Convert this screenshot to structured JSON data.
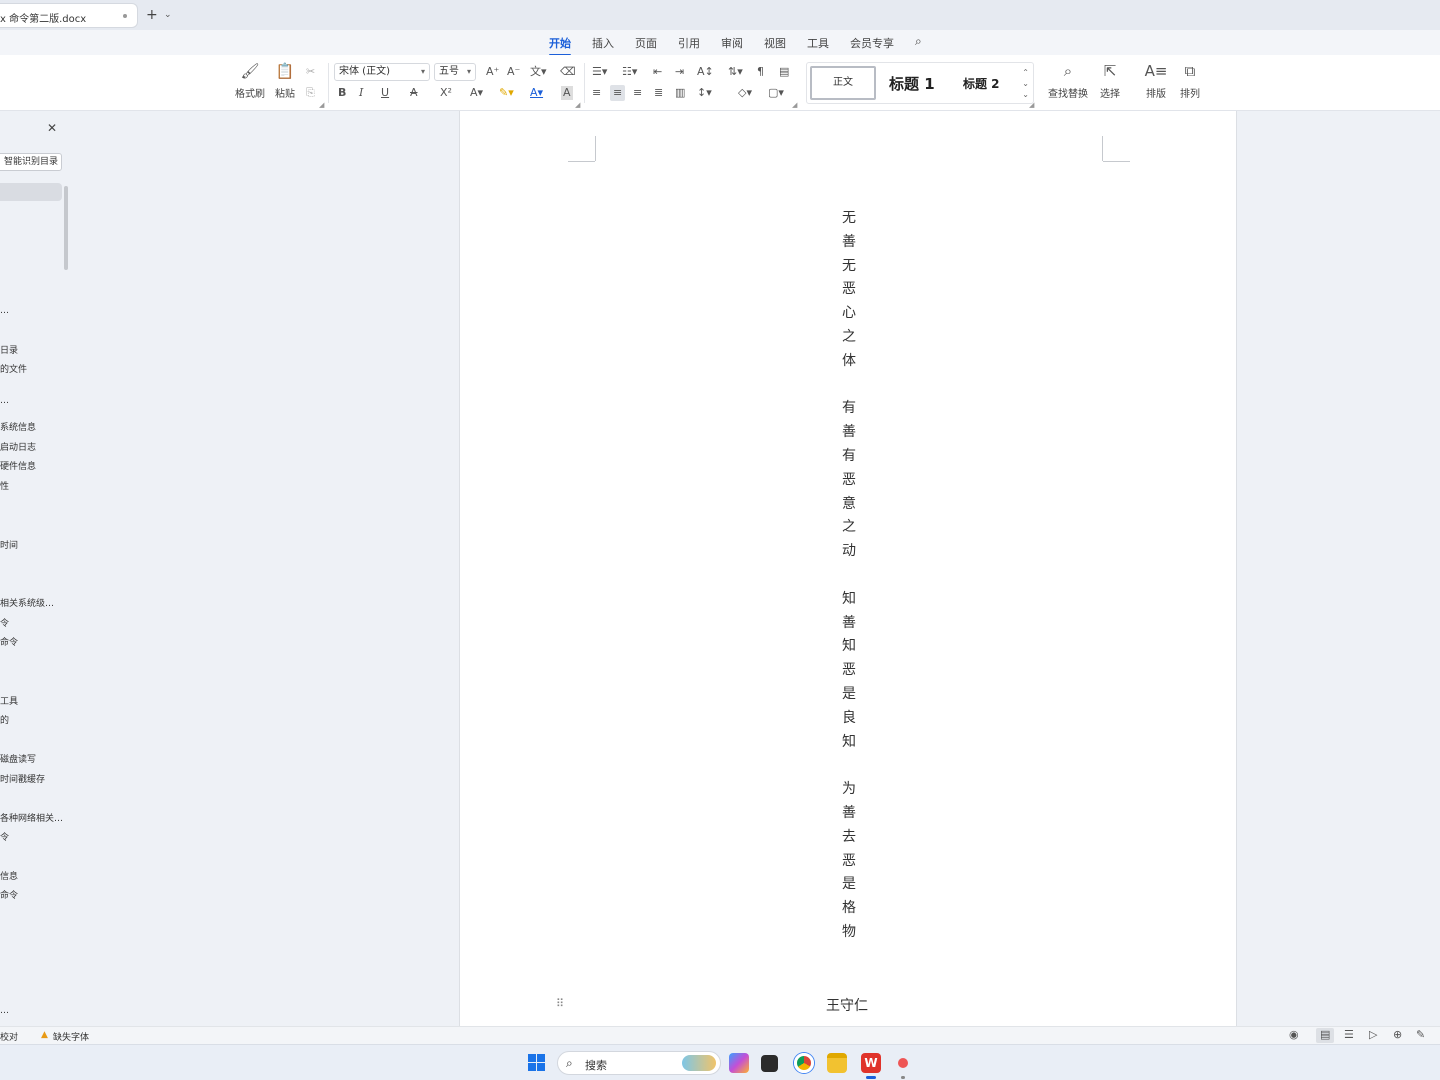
{
  "tab": {
    "title": "x 命令第二版.docx",
    "new_tab_label": "+",
    "dropdown": "⌄"
  },
  "ribbon_tabs": [
    {
      "label": "开始",
      "active": true
    },
    {
      "label": "插入"
    },
    {
      "label": "页面"
    },
    {
      "label": "引用"
    },
    {
      "label": "审阅"
    },
    {
      "label": "视图"
    },
    {
      "label": "工具"
    },
    {
      "label": "会员专享"
    }
  ],
  "toolbar": {
    "format_painter": "格式刷",
    "paste": "粘贴",
    "font_name": "宋体 (正文)",
    "font_size": "五号",
    "bold": "B",
    "italic": "I",
    "underline": "U",
    "strikethrough": "A",
    "superscript": "X²",
    "find_replace": "查找替换",
    "select": "选择",
    "layout": "排版",
    "arrange": "排列",
    "styles": {
      "normal": "正文",
      "h1": "标题 1",
      "h2": "标题 2"
    }
  },
  "nav": {
    "smart_toc": "智能识别目录",
    "items": [
      "…",
      "日录",
      "的文件",
      "…",
      "系统信息",
      "启动日志",
      "硬件信息",
      "性",
      "时间",
      "相关系统级…",
      "令",
      "命令",
      "工具",
      "的",
      "磁盘读写",
      "时间戳缓存",
      "各种网络相关…",
      "令",
      "信息",
      "命令",
      "…"
    ]
  },
  "document": {
    "lines": [
      "无善无恶心之体",
      "有善有恶意之动",
      "知善知恶是良知",
      "为善去恶是格物"
    ],
    "author": "王守仁"
  },
  "status": {
    "proofread": "校对",
    "missing_font": "缺失字体"
  },
  "taskbar": {
    "search_label": "搜索"
  },
  "colors": {
    "accent": "#1b5fd9",
    "warning": "#e89a15"
  }
}
